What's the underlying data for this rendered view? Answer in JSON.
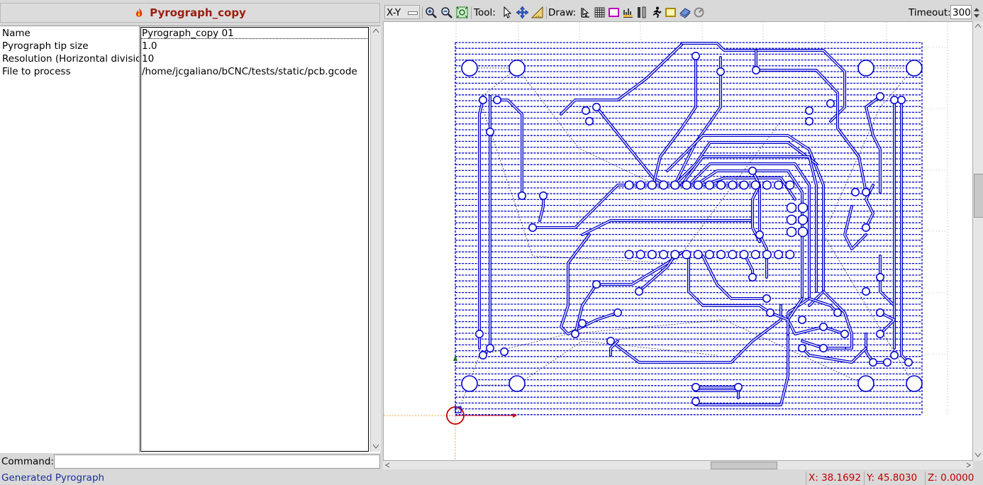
{
  "panel": {
    "title": "Pyrograph_copy",
    "properties": [
      {
        "name": "Name",
        "value": "Pyrograph_copy 01"
      },
      {
        "name": "Pyrograph tip size",
        "value": "1.0"
      },
      {
        "name": "Resolution (Horizontal divisio",
        "value": "10"
      },
      {
        "name": "File to process",
        "value": "/home/jcgaliano/bCNC/tests/static/pcb.gcode"
      }
    ]
  },
  "command": {
    "label": "Command:",
    "value": ""
  },
  "status": {
    "message": "Generated Pyrograph",
    "x": "X: 38.1692",
    "y": "Y: 45.8030",
    "z": "Z: 0.0000"
  },
  "toolbar": {
    "view_label": "X-Y",
    "tool_label": "Tool:",
    "draw_label": "Draw:",
    "timeout_label": "Timeout:",
    "timeout_value": "300",
    "icons": [
      "zoom-in-icon",
      "zoom-out-icon",
      "zoom-fit-icon",
      "select-icon",
      "pan-icon",
      "ruler-icon",
      "pointer-icon",
      "grid-icon",
      "margin-icon",
      "probe-icon",
      "axes-icon",
      "workarea-icon",
      "camera-icon",
      "rapid-icon",
      "paths-icon"
    ]
  },
  "colors": {
    "toolpath": "#0000cc",
    "rapid": "#1a1a4d",
    "title": "#9b1d0e",
    "status_text": "#1b2f9a",
    "coords": "#c00000",
    "origin": "#cc0000",
    "grid": "#808080"
  }
}
